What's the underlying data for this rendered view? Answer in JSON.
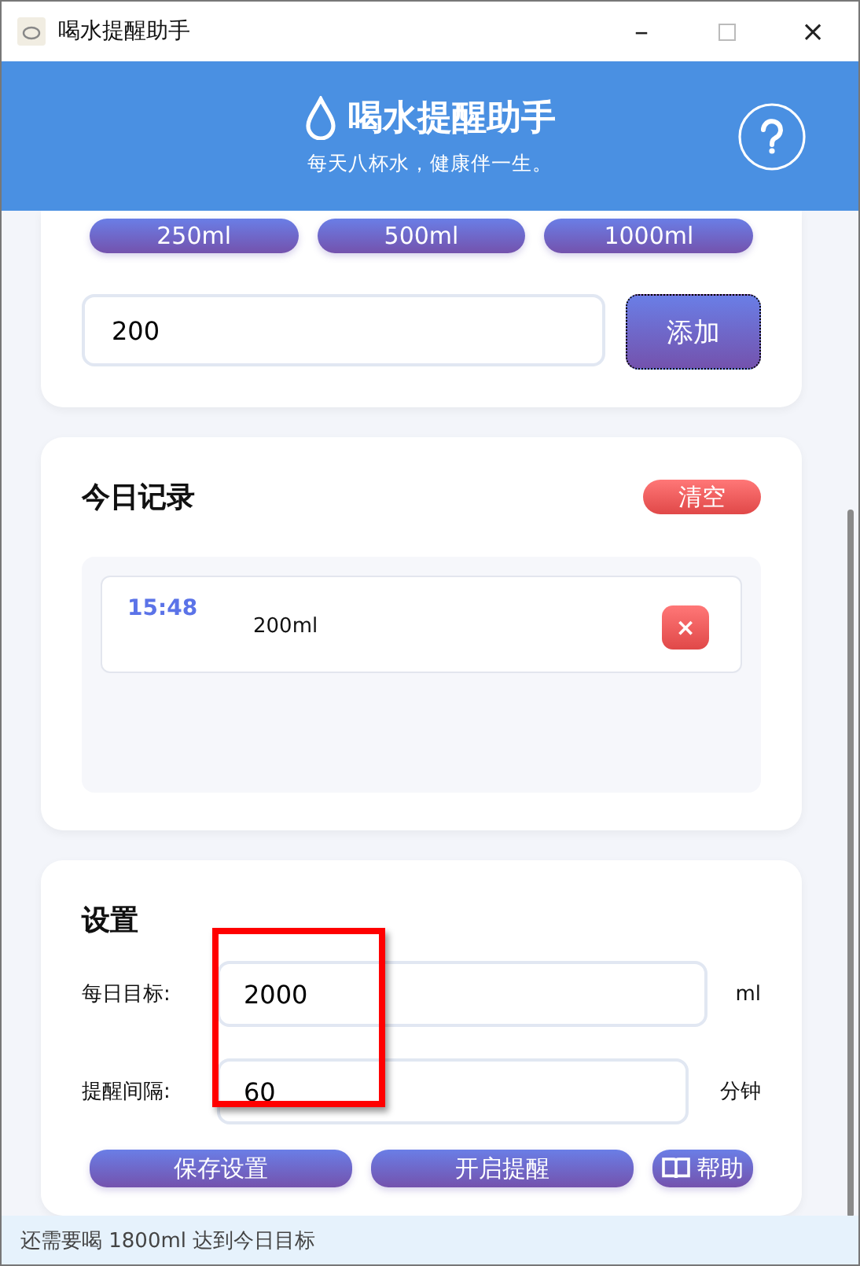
{
  "window": {
    "title": "喝水提醒助手",
    "controls": [
      "–",
      "×"
    ]
  },
  "header": {
    "title": "喝水提醒助手",
    "subtitle": "每天八杯水，健康伴一生。"
  },
  "quick_add": {
    "presets": [
      "250ml",
      "500ml",
      "1000ml"
    ],
    "amount": "200",
    "add_button": "添加"
  },
  "records": {
    "title": "今日记录",
    "clear_button": "清空",
    "items": [
      {
        "time": "15:48",
        "amount": "200ml",
        "delete": "×"
      }
    ]
  },
  "settings": {
    "title": "设置",
    "fields": [
      {
        "label": "每日目标:",
        "value": "2000",
        "unit": "ml"
      },
      {
        "label": "提醒间隔:",
        "value": "60",
        "unit": "分钟"
      }
    ],
    "buttons": [
      {
        "label": "保存设置",
        "kind": "plain"
      },
      {
        "label": "开启提醒",
        "kind": "plain"
      },
      {
        "label": "帮助",
        "kind": "help"
      }
    ]
  },
  "status_bar": "还需要喝 1800ml 达到今日目标"
}
